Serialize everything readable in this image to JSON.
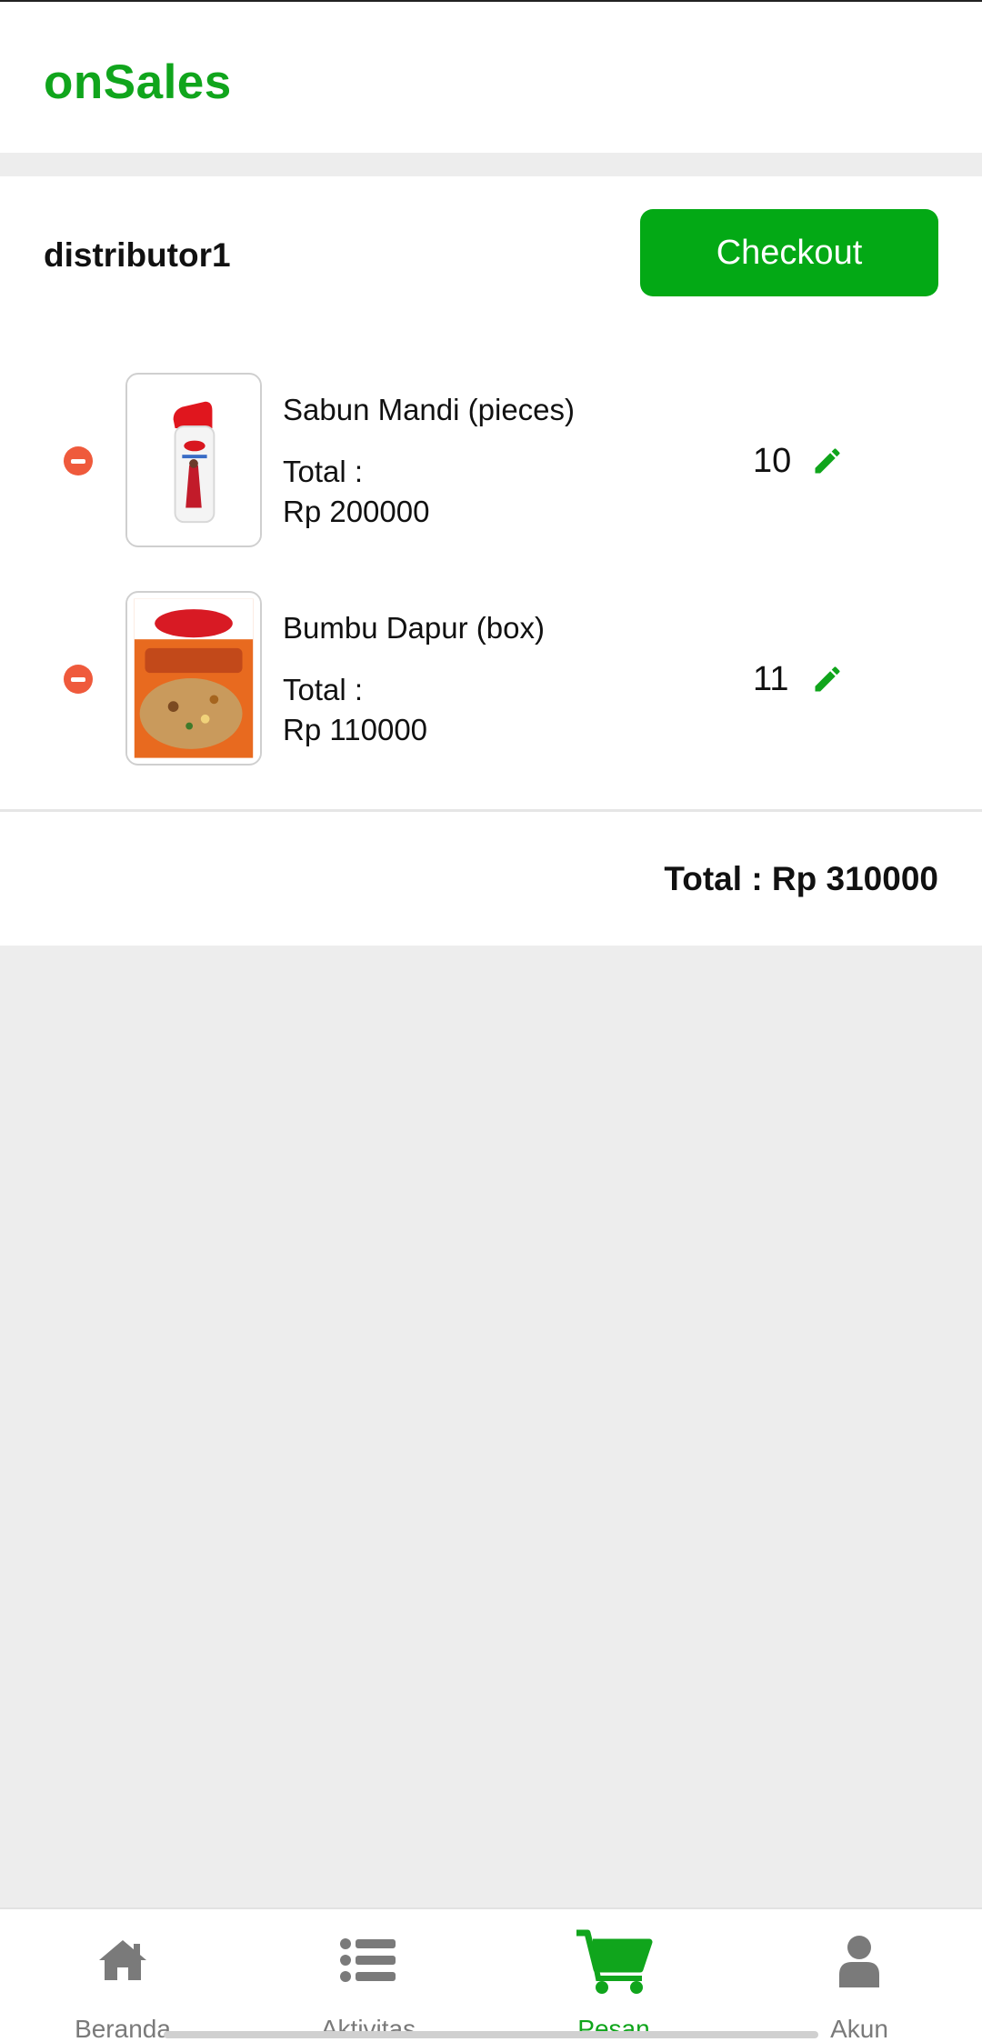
{
  "app": {
    "brand": "onSales",
    "brand_color": "#10a51c"
  },
  "cart": {
    "distributor": "distributor1",
    "checkout_label": "Checkout",
    "items": [
      {
        "name": "Sabun Mandi (pieces)",
        "total_label": "Total :",
        "total_value": "Rp 200000",
        "quantity": "10",
        "image": "soap-bottle-image"
      },
      {
        "name": "Bumbu Dapur (box)",
        "total_label": "Total :",
        "total_value": "Rp 110000",
        "quantity": "11",
        "image": "seasoning-pack-image"
      }
    ],
    "grand_total": "Total : Rp 310000"
  },
  "nav": {
    "items": [
      {
        "label": "Beranda",
        "icon": "home-icon",
        "active": false
      },
      {
        "label": "Aktivitas",
        "icon": "list-icon",
        "active": false
      },
      {
        "label": "Pesan",
        "icon": "cart-icon",
        "active": true
      },
      {
        "label": "Akun",
        "icon": "user-icon",
        "active": false
      }
    ]
  },
  "colors": {
    "accent": "#03a915",
    "remove": "#ef5a3c",
    "inactive": "#7a7a7a"
  }
}
